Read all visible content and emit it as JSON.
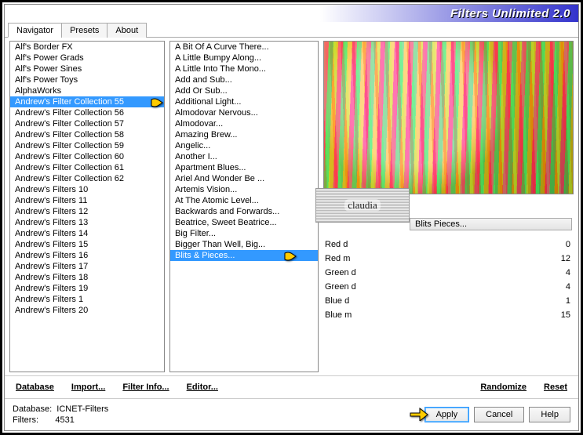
{
  "app_title": "Filters Unlimited 2.0",
  "tabs": [
    "Navigator",
    "Presets",
    "About"
  ],
  "active_tab": 0,
  "categories": [
    "Alf's Border FX",
    "Alf's Power Grads",
    "Alf's Power Sines",
    "Alf's Power Toys",
    "AlphaWorks",
    "Andrew's Filter Collection 55",
    "Andrew's Filter Collection 56",
    "Andrew's Filter Collection 57",
    "Andrew's Filter Collection 58",
    "Andrew's Filter Collection 59",
    "Andrew's Filter Collection 60",
    "Andrew's Filter Collection 61",
    "Andrew's Filter Collection 62",
    "Andrew's Filters 10",
    "Andrew's Filters 11",
    "Andrew's Filters 12",
    "Andrew's Filters 13",
    "Andrew's Filters 14",
    "Andrew's Filters 15",
    "Andrew's Filters 16",
    "Andrew's Filters 17",
    "Andrew's Filters 18",
    "Andrew's Filters 19",
    "Andrew's Filters 1",
    "Andrew's Filters 20"
  ],
  "categories_selected_index": 5,
  "filters": [
    "A Bit Of A Curve There...",
    "A Little Bumpy Along...",
    "A Little Into The Mono...",
    "Add and Sub...",
    "Add Or Sub...",
    "Additional Light...",
    "Almodovar Nervous...",
    "Almodovar...",
    "Amazing Brew...",
    "Angelic...",
    "Another I...",
    "Apartment Blues...",
    "Ariel And Wonder Be ...",
    "Artemis Vision...",
    "At The Atomic Level...",
    "Backwards and Forwards...",
    "Beatrice, Sweet Beatrice...",
    "Big Filter...",
    "Bigger Than Well, Big...",
    "Blits & Pieces..."
  ],
  "filters_selected_index": 19,
  "badge_text": "claudia",
  "current_filter_display": "Blits  Pieces...",
  "params": [
    {
      "label": "Red d",
      "value": 0
    },
    {
      "label": "Red m",
      "value": 12
    },
    {
      "label": "Green d",
      "value": 4
    },
    {
      "label": "Green d",
      "value": 4
    },
    {
      "label": "Blue d",
      "value": 1
    },
    {
      "label": "Blue m",
      "value": 15
    }
  ],
  "toolbar": {
    "database": "Database",
    "import": "Import...",
    "filter_info": "Filter Info...",
    "editor": "Editor...",
    "randomize": "Randomize",
    "reset": "Reset"
  },
  "footer": {
    "db_label": "Database:",
    "db_value": "ICNET-Filters",
    "filters_label": "Filters:",
    "filters_value": "4531",
    "apply": "Apply",
    "cancel": "Cancel",
    "help": "Help"
  }
}
